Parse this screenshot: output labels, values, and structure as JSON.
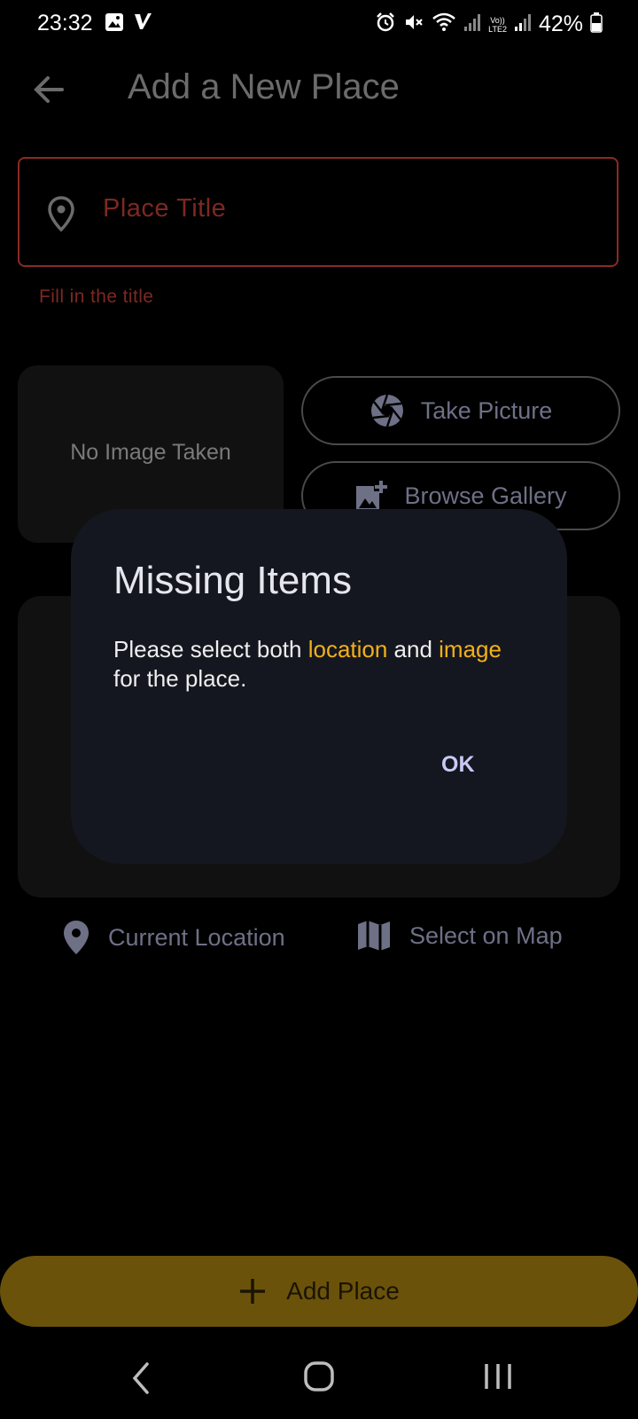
{
  "status_bar": {
    "time": "23:32",
    "battery": "42%",
    "lte_label": "LTE2",
    "volte_label": "Vo))"
  },
  "app_bar": {
    "title": "Add a New Place"
  },
  "title_field": {
    "placeholder": "Place Title",
    "error": "Fill in the title"
  },
  "image_section": {
    "empty_text": "No Image Taken",
    "take_picture_label": "Take Picture",
    "browse_gallery_label": "Browse Gallery"
  },
  "location_section": {
    "current_location_label": "Current Location",
    "select_on_map_label": "Select on Map"
  },
  "submit": {
    "label": "Add Place"
  },
  "dialog": {
    "title": "Missing Items",
    "body_part1": "Please select both ",
    "body_highlight1": "location",
    "body_part2": " and ",
    "body_highlight2": "image",
    "body_part3": " for the place.",
    "ok_label": "OK"
  },
  "colors": {
    "error": "#7d2822",
    "accent": "#6b520b",
    "highlight": "#f2b118",
    "dialog_bg": "#151720"
  }
}
